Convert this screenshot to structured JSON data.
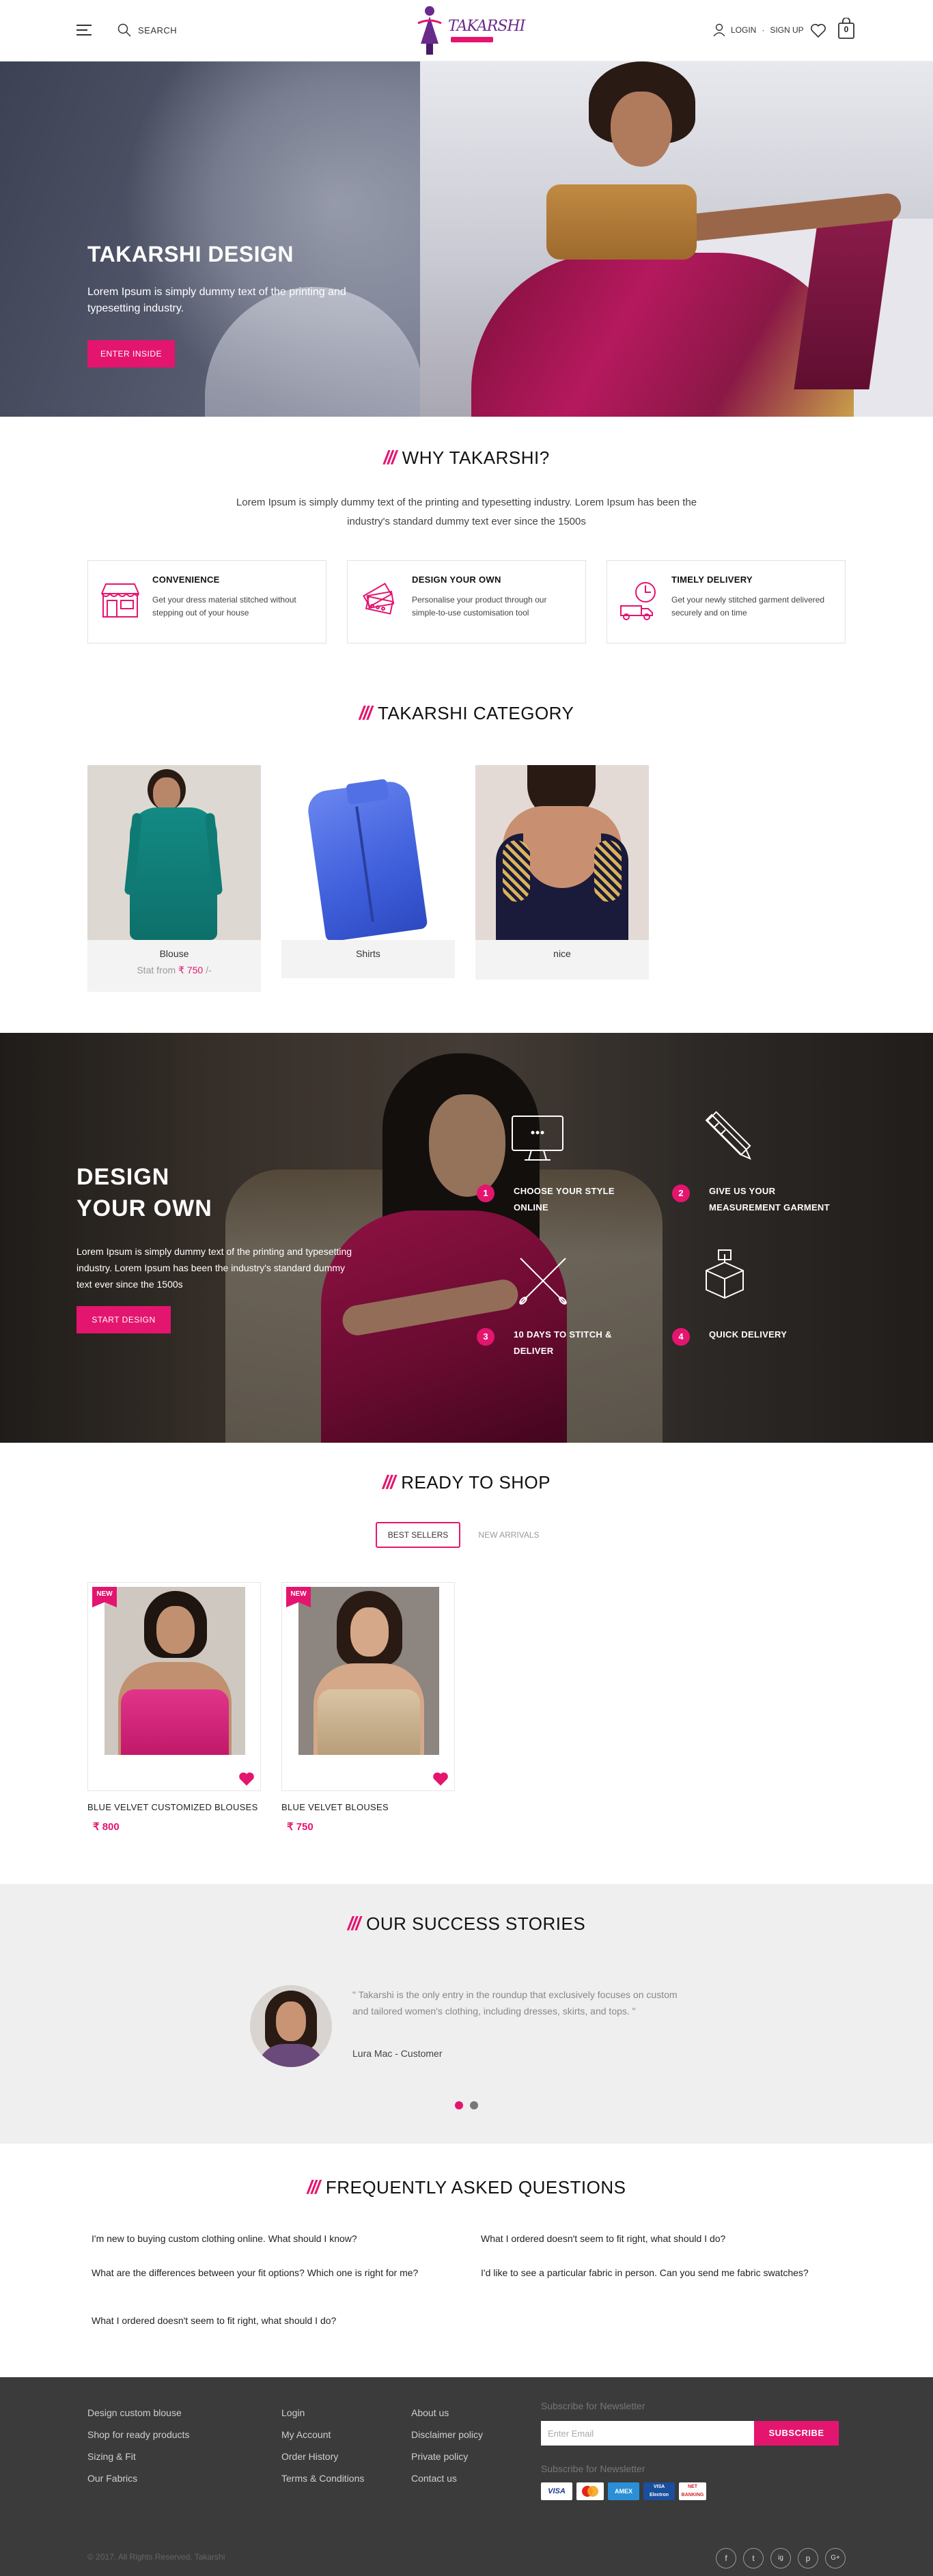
{
  "header": {
    "search_label": "SEARCH",
    "logo_text": "TAKARSHI",
    "login_label": "LOGIN",
    "signup_label": "SIGN UP",
    "login_separator": "·",
    "cart_count": "0"
  },
  "hero": {
    "title": "TAKARSHI DESIGN",
    "description": "Lorem Ipsum is simply dummy text of the printing and typesetting industry.",
    "button": "ENTER INSIDE"
  },
  "why": {
    "slashes": "///",
    "title": "WHY TAKARSHI?",
    "description": "Lorem Ipsum is simply dummy text of the printing and typesetting industry. Lorem Ipsum has been the industry's standard dummy text ever since the 1500s",
    "cards": [
      {
        "icon": "shop-icon",
        "title": "CONVENIENCE",
        "desc": "Get your dress material stitched without stepping out of your house"
      },
      {
        "icon": "fabric-swatch-icon",
        "title": "DESIGN YOUR OWN",
        "desc": "Personalise your product through our simple-to-use customisation tool"
      },
      {
        "icon": "delivery-truck-icon",
        "title": "TIMELY DELIVERY",
        "desc": "Get your newly stitched garment delivered securely and on time"
      }
    ]
  },
  "category": {
    "title": "TAKARSHI CATEGORY",
    "items": [
      {
        "name": "Blouse",
        "price_prefix": "Stat from",
        "price": "₹ 750",
        "price_suffix": " /-"
      },
      {
        "name": "Shirts"
      },
      {
        "name": "nice"
      }
    ]
  },
  "design_own": {
    "title_line1": "DESIGN",
    "title_line2": "YOUR OWN",
    "description": "Lorem Ipsum is simply dummy text of the printing and typesetting industry. Lorem Ipsum has been the industry's standard dummy text ever since the 1500s",
    "button": "START DESIGN",
    "steps": [
      {
        "num": "1",
        "label": "CHOOSE YOUR STYLE ONLINE",
        "icon": "monitor-icon"
      },
      {
        "num": "2",
        "label": "GIVE US YOUR MEASUREMENT GARMENT",
        "icon": "pencil-ruler-icon"
      },
      {
        "num": "3",
        "label": "10 DAYS TO STITCH & DELIVER",
        "icon": "needle-thread-icon"
      },
      {
        "num": "4",
        "label": "QUICK DELIVERY",
        "icon": "package-icon"
      }
    ]
  },
  "shop": {
    "title": "READY TO SHOP",
    "tabs": [
      "BEST SELLERS",
      "NEW ARRIVALS"
    ],
    "products": [
      {
        "badge": "NEW",
        "name": "BLUE VELVET CUSTOMIZED BLOUSES",
        "price": "₹ 800"
      },
      {
        "badge": "NEW",
        "name": "BLUE VELVET BLOUSES",
        "price": "₹ 750"
      }
    ]
  },
  "success": {
    "title": "OUR SUCCESS STORIES",
    "quote": "\" Takarshi is the only entry in the roundup that exclusively focuses on custom and tailored women's clothing, including dresses, skirts, and tops. \"",
    "author": "Lura Mac - Customer"
  },
  "faq": {
    "title": "FREQUENTLY ASKED QUESTIONS",
    "questions": [
      "I'm new to buying custom clothing online. What should I know?",
      "What I ordered doesn't seem to fit right, what should I do?",
      "What are the differences between your fit options? Which one is right for me?",
      "I'd like to see a particular fabric in person. Can you send me fabric swatches?",
      "What I ordered doesn't seem to fit right, what should I do?"
    ]
  },
  "footer": {
    "col1": [
      "Design custom blouse",
      "Shop for ready products",
      "Sizing & Fit",
      "Our Fabrics"
    ],
    "col2": [
      "Login",
      "My Account",
      "Order History",
      "Terms & Conditions"
    ],
    "col3": [
      "About us",
      "Disclaimer policy",
      "Private policy",
      "Contact us"
    ],
    "newsletter_label": "Subscribe for Newsletter",
    "email_placeholder": "Enter Email",
    "subscribe": "SUBSCRIBE",
    "payments_label": "Subscribe for Newsletter",
    "cards": [
      "VISA",
      "MC",
      "AMEX",
      "VISA Electron",
      "NET BANKING"
    ],
    "copyright": "© 2017. All Rights Reserved. Takarshi",
    "social": [
      "f",
      "t",
      "ig",
      "p",
      "G+"
    ]
  },
  "colors": {
    "accent": "#e4156f",
    "footer_bg": "#3b3b3b",
    "section_grey": "#efefef"
  }
}
